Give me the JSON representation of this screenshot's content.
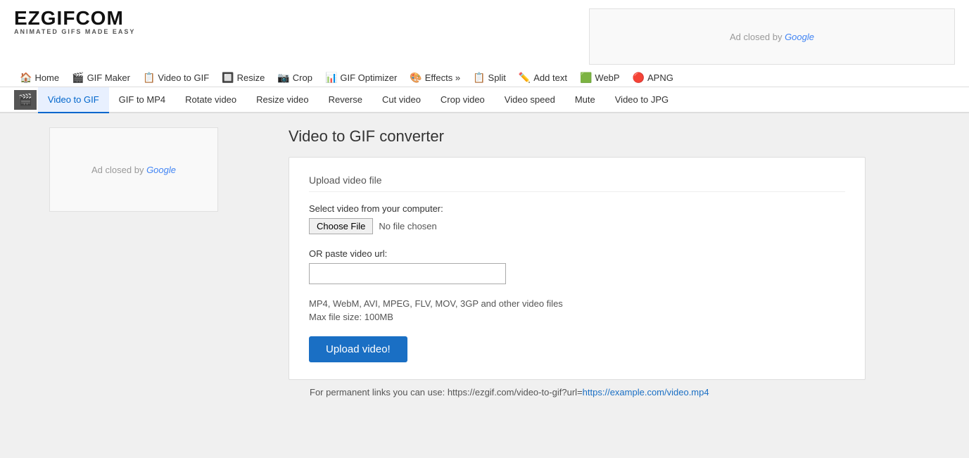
{
  "logo": {
    "main": "EZGIFCOM",
    "sub": "ANIMATED GIFS MADE EASY"
  },
  "ad_top": {
    "text": "Ad closed by ",
    "brand": "Google"
  },
  "main_nav": [
    {
      "id": "home",
      "icon": "🏠",
      "label": "Home"
    },
    {
      "id": "gif-maker",
      "icon": "🎬",
      "label": "GIF Maker"
    },
    {
      "id": "video-to-gif",
      "icon": "📋",
      "label": "Video to GIF"
    },
    {
      "id": "resize",
      "icon": "🔲",
      "label": "Resize"
    },
    {
      "id": "crop",
      "icon": "📷",
      "label": "Crop"
    },
    {
      "id": "gif-optimizer",
      "icon": "📊",
      "label": "GIF Optimizer"
    },
    {
      "id": "effects",
      "icon": "🎨",
      "label": "Effects »"
    },
    {
      "id": "split",
      "icon": "📋",
      "label": "Split"
    },
    {
      "id": "add-text",
      "icon": "✏️",
      "label": "Add text"
    },
    {
      "id": "webp",
      "icon": "🟩",
      "label": "WebP"
    },
    {
      "id": "apng",
      "icon": "🔴",
      "label": "APNG"
    }
  ],
  "sub_nav": [
    {
      "id": "film",
      "icon": "🎬",
      "label": "",
      "is_icon": true
    },
    {
      "id": "video-to-gif",
      "label": "Video to GIF",
      "active": true
    },
    {
      "id": "gif-to-mp4",
      "label": "GIF to MP4",
      "active": false
    },
    {
      "id": "rotate-video",
      "label": "Rotate video",
      "active": false
    },
    {
      "id": "resize-video",
      "label": "Resize video",
      "active": false
    },
    {
      "id": "reverse",
      "label": "Reverse",
      "active": false
    },
    {
      "id": "cut-video",
      "label": "Cut video",
      "active": false
    },
    {
      "id": "crop-video",
      "label": "Crop video",
      "active": false
    },
    {
      "id": "video-speed",
      "label": "Video speed",
      "active": false
    },
    {
      "id": "mute",
      "label": "Mute",
      "active": false
    },
    {
      "id": "video-to-jpg",
      "label": "Video to JPG",
      "active": false
    }
  ],
  "ad_sidebar": {
    "text": "Ad closed by ",
    "brand": "Google"
  },
  "page": {
    "title": "Video to GIF converter",
    "upload_section_title": "Upload video file",
    "select_label": "Select video from your computer:",
    "choose_file_btn": "Choose File",
    "no_file_text": "No file chosen",
    "or_paste_label": "OR paste video url:",
    "url_placeholder": "",
    "formats_text": "MP4, WebM, AVI, MPEG, FLV, MOV, 3GP and other video files",
    "maxsize_text": "Max file size: 100MB",
    "upload_btn": "Upload video!",
    "footer_note_prefix": "For permanent links you can use: https://ezgif.com/video-to-gif?url=",
    "footer_link": "https://example.com/video.mp4"
  }
}
